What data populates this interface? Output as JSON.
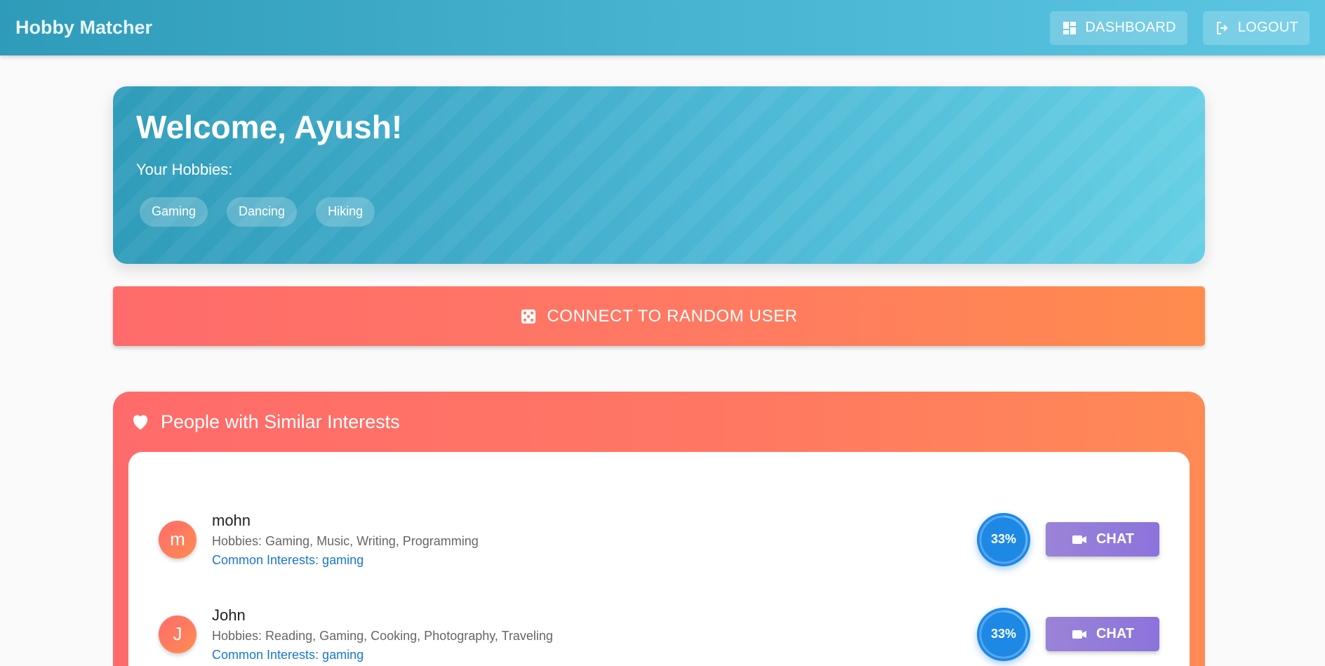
{
  "appbar": {
    "brand": "Hobby Matcher",
    "dashboard_label": "DASHBOARD",
    "logout_label": "LOGOUT"
  },
  "welcome": {
    "title": "Welcome, Ayush!",
    "hobbies_label": "Your Hobbies:",
    "hobbies": [
      "Gaming",
      "Dancing",
      "Hiking"
    ]
  },
  "random": {
    "label": "CONNECT TO RANDOM USER"
  },
  "similar": {
    "title": "People with Similar Interests",
    "users": [
      {
        "initial": "m",
        "name": "mohn",
        "hobbies": "Hobbies: Gaming, Music, Writing, Programming",
        "common": "Common Interests: gaming",
        "match": "33%",
        "match_value": 33,
        "chat_label": "CHAT"
      },
      {
        "initial": "J",
        "name": "John",
        "hobbies": "Hobbies: Reading, Gaming, Cooking, Photography, Traveling",
        "common": "Common Interests: gaming",
        "match": "33%",
        "match_value": 33,
        "chat_label": "CHAT"
      }
    ]
  },
  "colors": {
    "primary": "#2e9bb9",
    "accent": "#ff6b6b",
    "match": "#1e88e5",
    "chat": "#8b73dc",
    "link": "#1976d2"
  }
}
